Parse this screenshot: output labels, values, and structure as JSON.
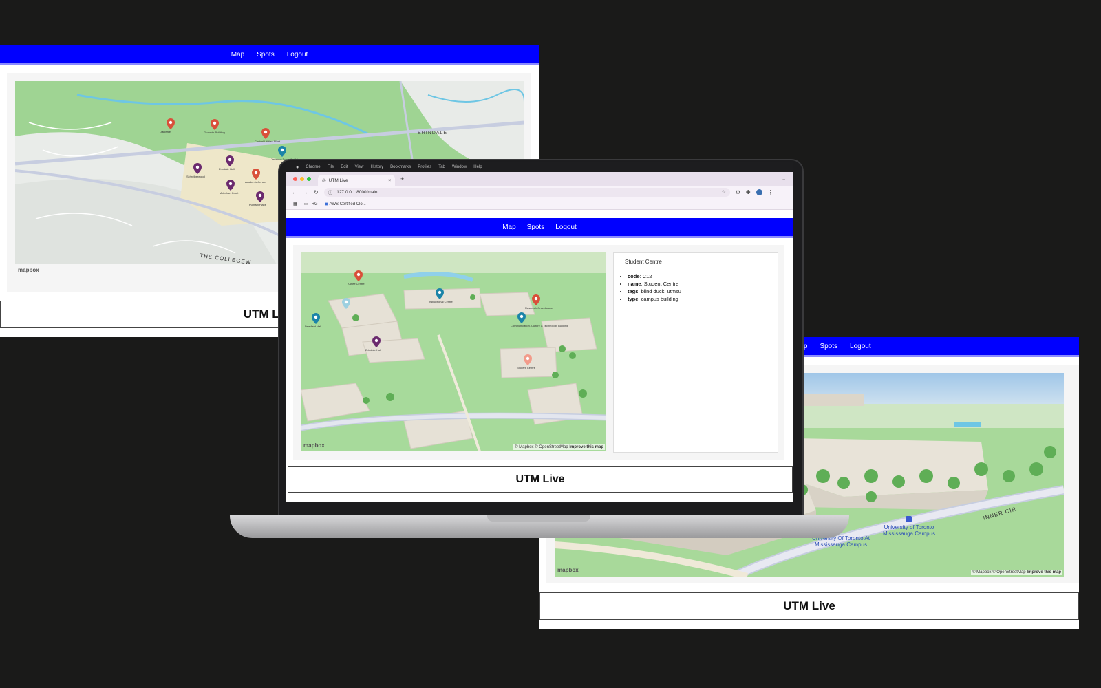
{
  "nav": {
    "map": "Map",
    "spots": "Spots",
    "logout": "Logout"
  },
  "footer_title": "UTM Live",
  "left_map": {
    "area_label": "ERINDALE",
    "road_label": "THE COLLEGEW",
    "logo": "mapbox",
    "pins": [
      {
        "label": "Oakleafe",
        "color": "#d9503a"
      },
      {
        "label": "Grounds Building",
        "color": "#d9503a"
      },
      {
        "label": "Central Utilities Plant",
        "color": "#d9503a"
      },
      {
        "label": "Terrence Donnelly Science",
        "color": "#1b84a8"
      },
      {
        "label": "Schreiberwood",
        "color": "#6b2a6e"
      },
      {
        "label": "Erindale Hall",
        "color": "#6b2a6e"
      },
      {
        "label": "Academic Annex",
        "color": "#d9503a"
      },
      {
        "label": "McLuhan Court",
        "color": "#6b2a6e"
      },
      {
        "label": "Putnam Place",
        "color": "#6b2a6e"
      }
    ]
  },
  "browser": {
    "menubar": [
      "Chrome",
      "File",
      "Edit",
      "View",
      "History",
      "Bookmarks",
      "Profiles",
      "Tab",
      "Window",
      "Help"
    ],
    "tab_title": "UTM Live",
    "new_tab": "+",
    "url": "127.0.0.1:8000/main",
    "bookmarks": [
      {
        "label": "TRG"
      },
      {
        "label": "AWS Certified Clo..."
      }
    ]
  },
  "center_map": {
    "logo": "mapbox",
    "attribution": "© Mapbox © OpenStreetMap",
    "improve": "Improve this map",
    "pins": [
      {
        "label": "Kaneff Centre",
        "color": "#d9503a"
      },
      {
        "label": "",
        "color": "#9dd0e0"
      },
      {
        "label": "Deerfield Hall",
        "color": "#1b84a8"
      },
      {
        "label": "Instructional Centre",
        "color": "#1b84a8"
      },
      {
        "label": "Research Greenhouse",
        "color": "#d9503a"
      },
      {
        "label": "Communication, Culture & Technology Building",
        "color": "#1b84a8"
      },
      {
        "label": "Erindale Hall",
        "color": "#6b2a6e"
      },
      {
        "label": "Student Centre",
        "color": "#f29b8a"
      }
    ]
  },
  "spot": {
    "title": "Student Centre",
    "fields": [
      {
        "key": "code",
        "value": "C12"
      },
      {
        "key": "name",
        "value": "Student Centre"
      },
      {
        "key": "tags",
        "value": "blind duck, utmsu"
      },
      {
        "key": "type",
        "value": "campus building"
      }
    ]
  },
  "right_map": {
    "road_label": "INNER CIR",
    "place_1": "University of Toronto Mississauga Campus",
    "place_2": "University Of Toronto At Mississauga Campus",
    "logo": "mapbox",
    "attribution": "© Mapbox © OpenStreetMap",
    "improve": "Improve this map"
  }
}
